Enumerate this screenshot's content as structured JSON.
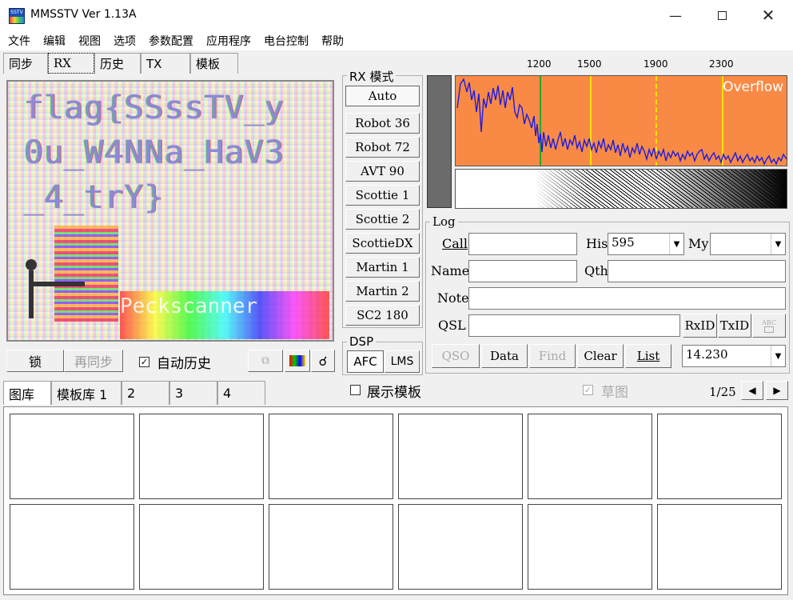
{
  "window": {
    "title": "MMSSTV Ver 1.13A"
  },
  "menu": [
    "文件",
    "编辑",
    "视图",
    "选项",
    "参数配置",
    "应用程序",
    "电台控制",
    "帮助"
  ],
  "top_tabs": [
    "同步",
    "RX",
    "历史",
    "TX",
    "模板"
  ],
  "rx_image": {
    "text_lines": [
      "flag{SSssTV_y",
      "0u_W4NNa_HaV3",
      "_4_trY}"
    ],
    "bottom_text": "Peckscanner"
  },
  "rx_controls": {
    "lock": "锁",
    "resync": "再同步",
    "auto_history": "自动历史"
  },
  "rx_mode": {
    "label": "RX 模式",
    "modes": [
      "Auto",
      "Robot 36",
      "Robot 72",
      "AVT 90",
      "Scottie 1",
      "Scottie 2",
      "ScottieDX",
      "Martin 1",
      "Martin 2",
      "SC2 180"
    ]
  },
  "dsp": {
    "label": "DSP",
    "afc": "AFC",
    "lms": "LMS"
  },
  "spectrum": {
    "ticks": [
      "1200",
      "1500",
      "1900",
      "2300"
    ],
    "overflow": "Overflow"
  },
  "log": {
    "label": "Log",
    "call_label": "Call",
    "his_label": "His",
    "his_value": "595",
    "my_label": "My",
    "name_label": "Name",
    "qth_label": "Qth",
    "note_label": "Note",
    "qsl_label": "QSL",
    "rxid": "RxID",
    "txid": "TxID",
    "abc": "ABC",
    "buttons": {
      "qso": "QSO",
      "data": "Data",
      "find": "Find",
      "clear": "Clear",
      "list": "List"
    },
    "freq": "14.230"
  },
  "bottom_tabs": [
    "图库",
    "模板库 1",
    "2",
    "3",
    "4"
  ],
  "show_template": "展示模板",
  "draft": "草图",
  "page_indicator": "1/25",
  "colors": {
    "spectrum_bg": "#f98a46",
    "trace": "#1c1ce0",
    "marker": "#f7e300",
    "green_marker": "#2aa52a"
  }
}
